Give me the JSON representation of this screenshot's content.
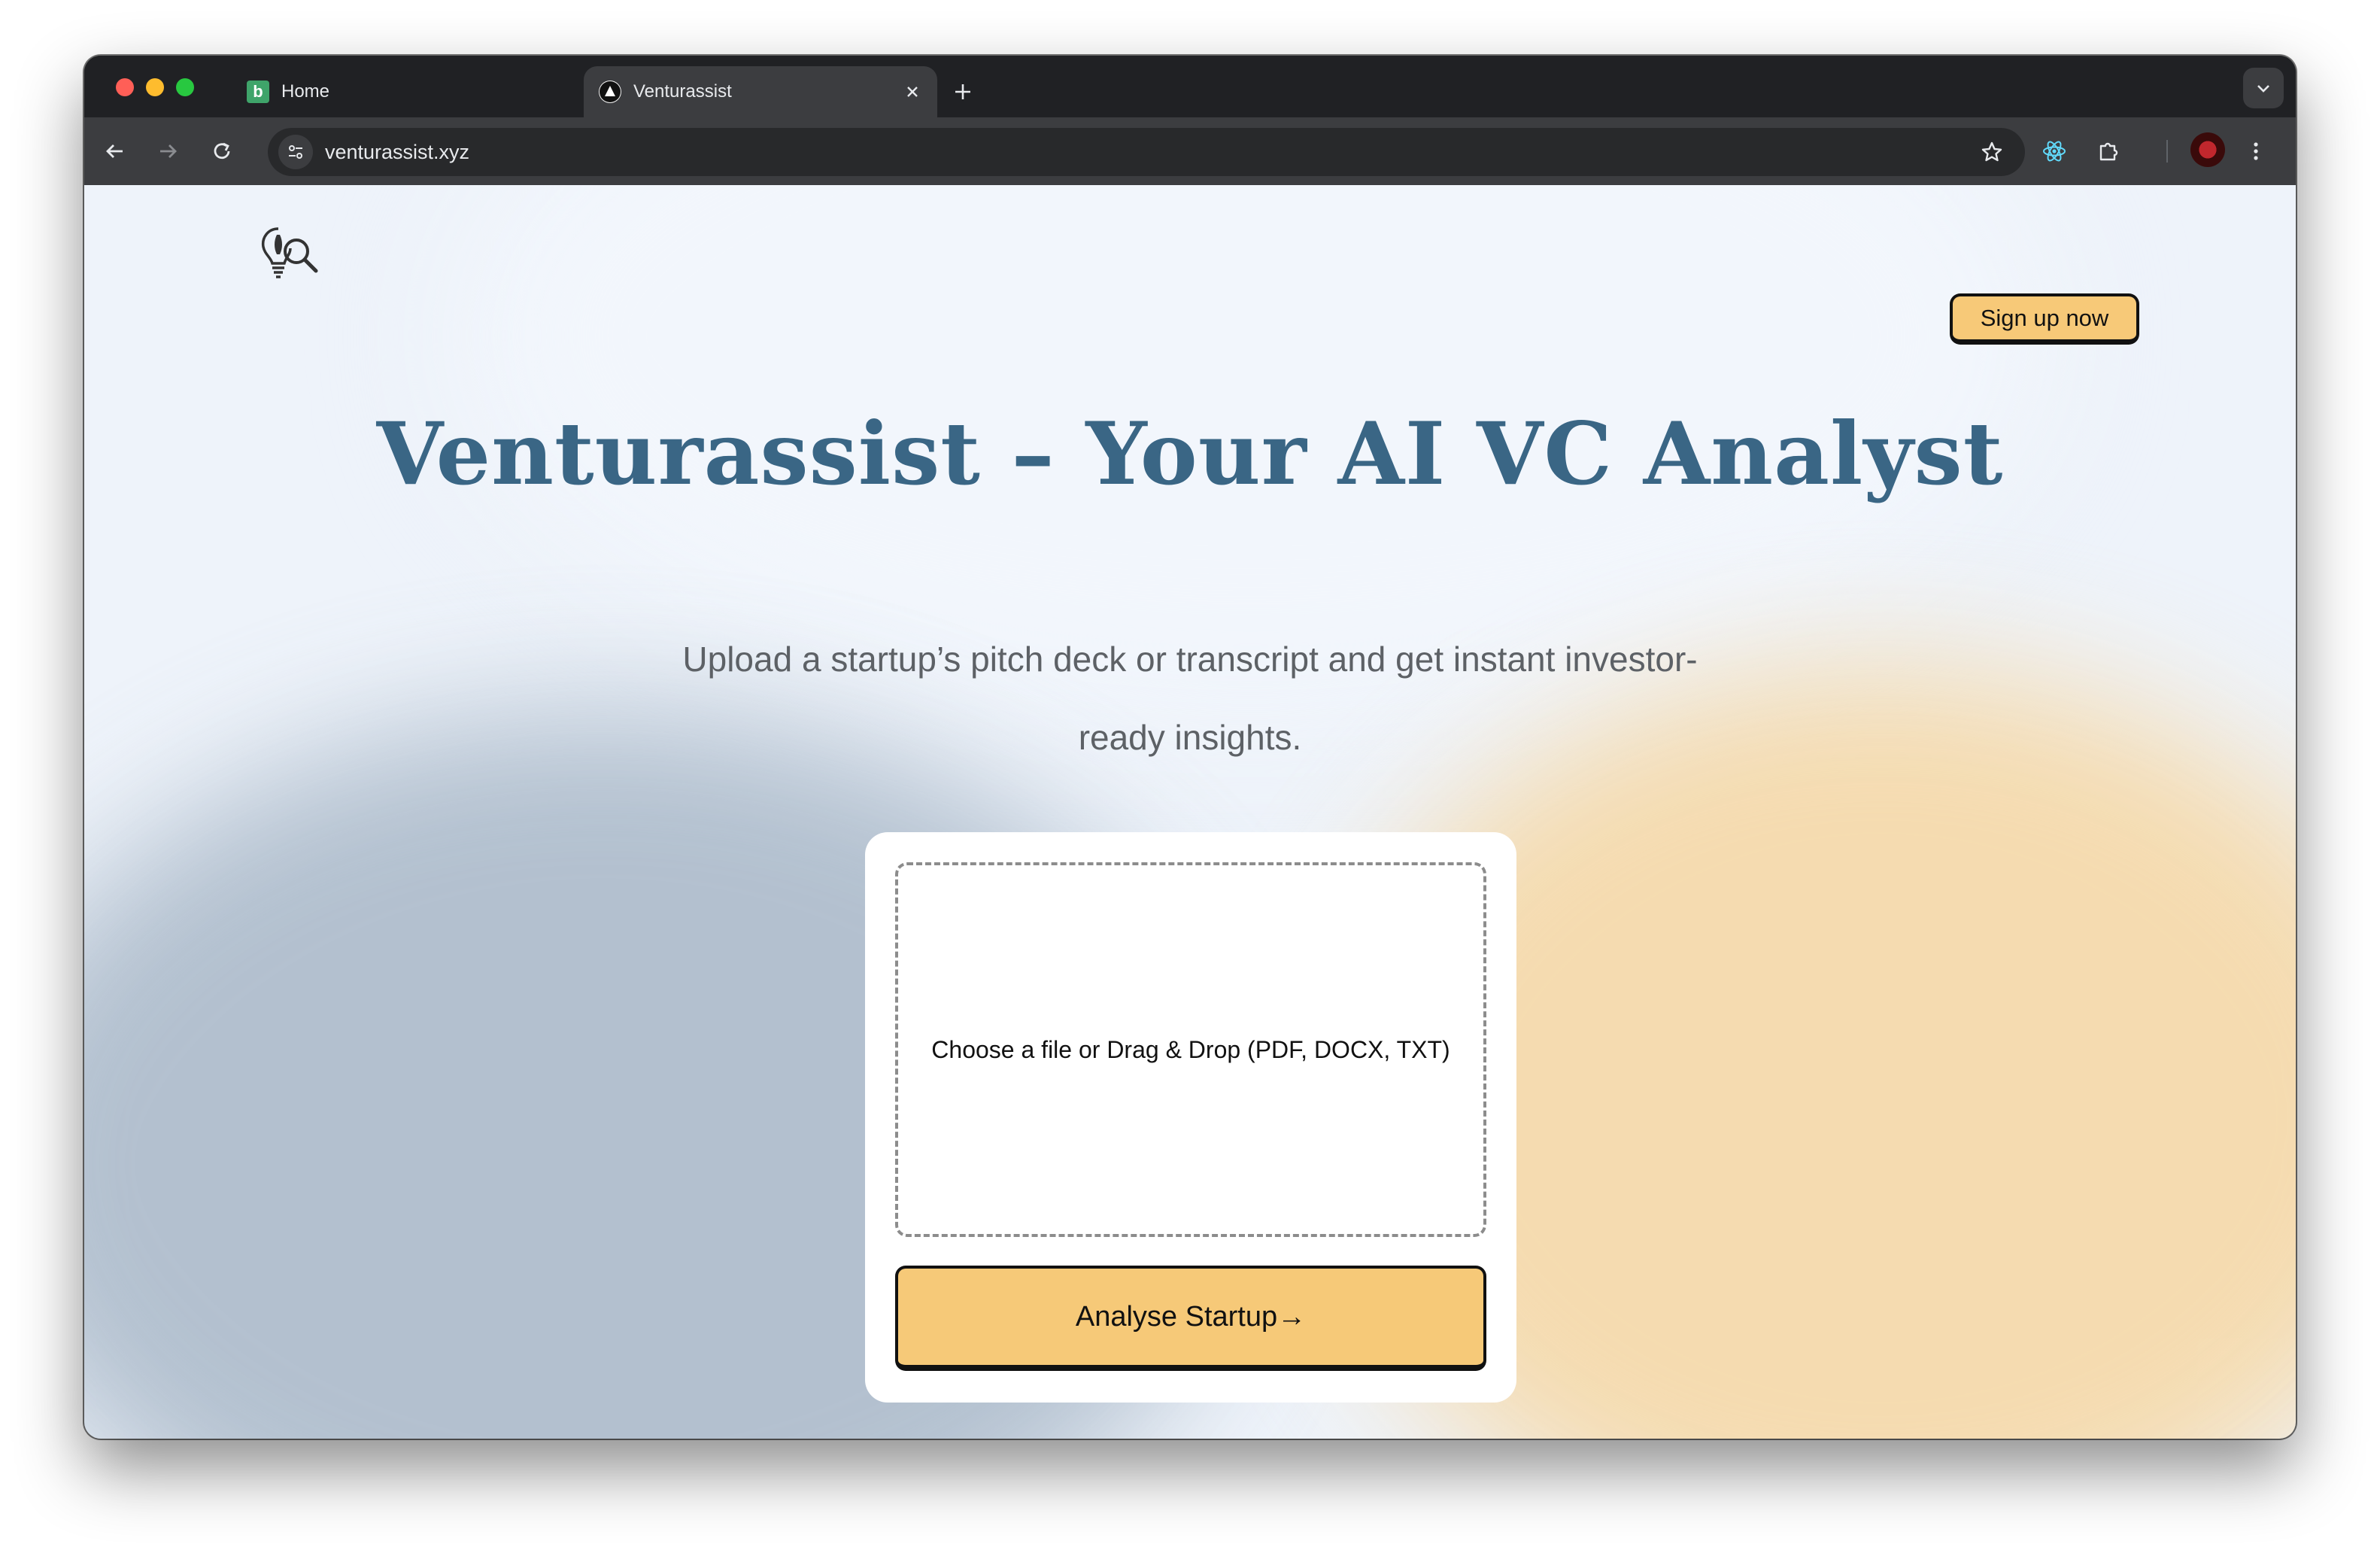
{
  "browser": {
    "tabs": [
      {
        "title": "Home",
        "favicon": "bolt-green-icon",
        "active": false
      },
      {
        "title": "Venturassist",
        "favicon": "triangle-logo-icon",
        "active": true
      }
    ],
    "url": "venturassist.xyz"
  },
  "header": {
    "logo": "lightbulb-magnifier-logo",
    "signup_label": "Sign up now"
  },
  "hero": {
    "title": "Venturassist – Your AI VC Analyst",
    "subtitle": "Upload a startup’s pitch deck or transcript and get instant investor-ready insights."
  },
  "upload": {
    "dropzone_text": "Choose a file or Drag & Drop (PDF, DOCX, TXT)",
    "submit_label": "Analyse Startup→"
  },
  "colors": {
    "accent": "#f6c978",
    "title": "#3a6685"
  }
}
